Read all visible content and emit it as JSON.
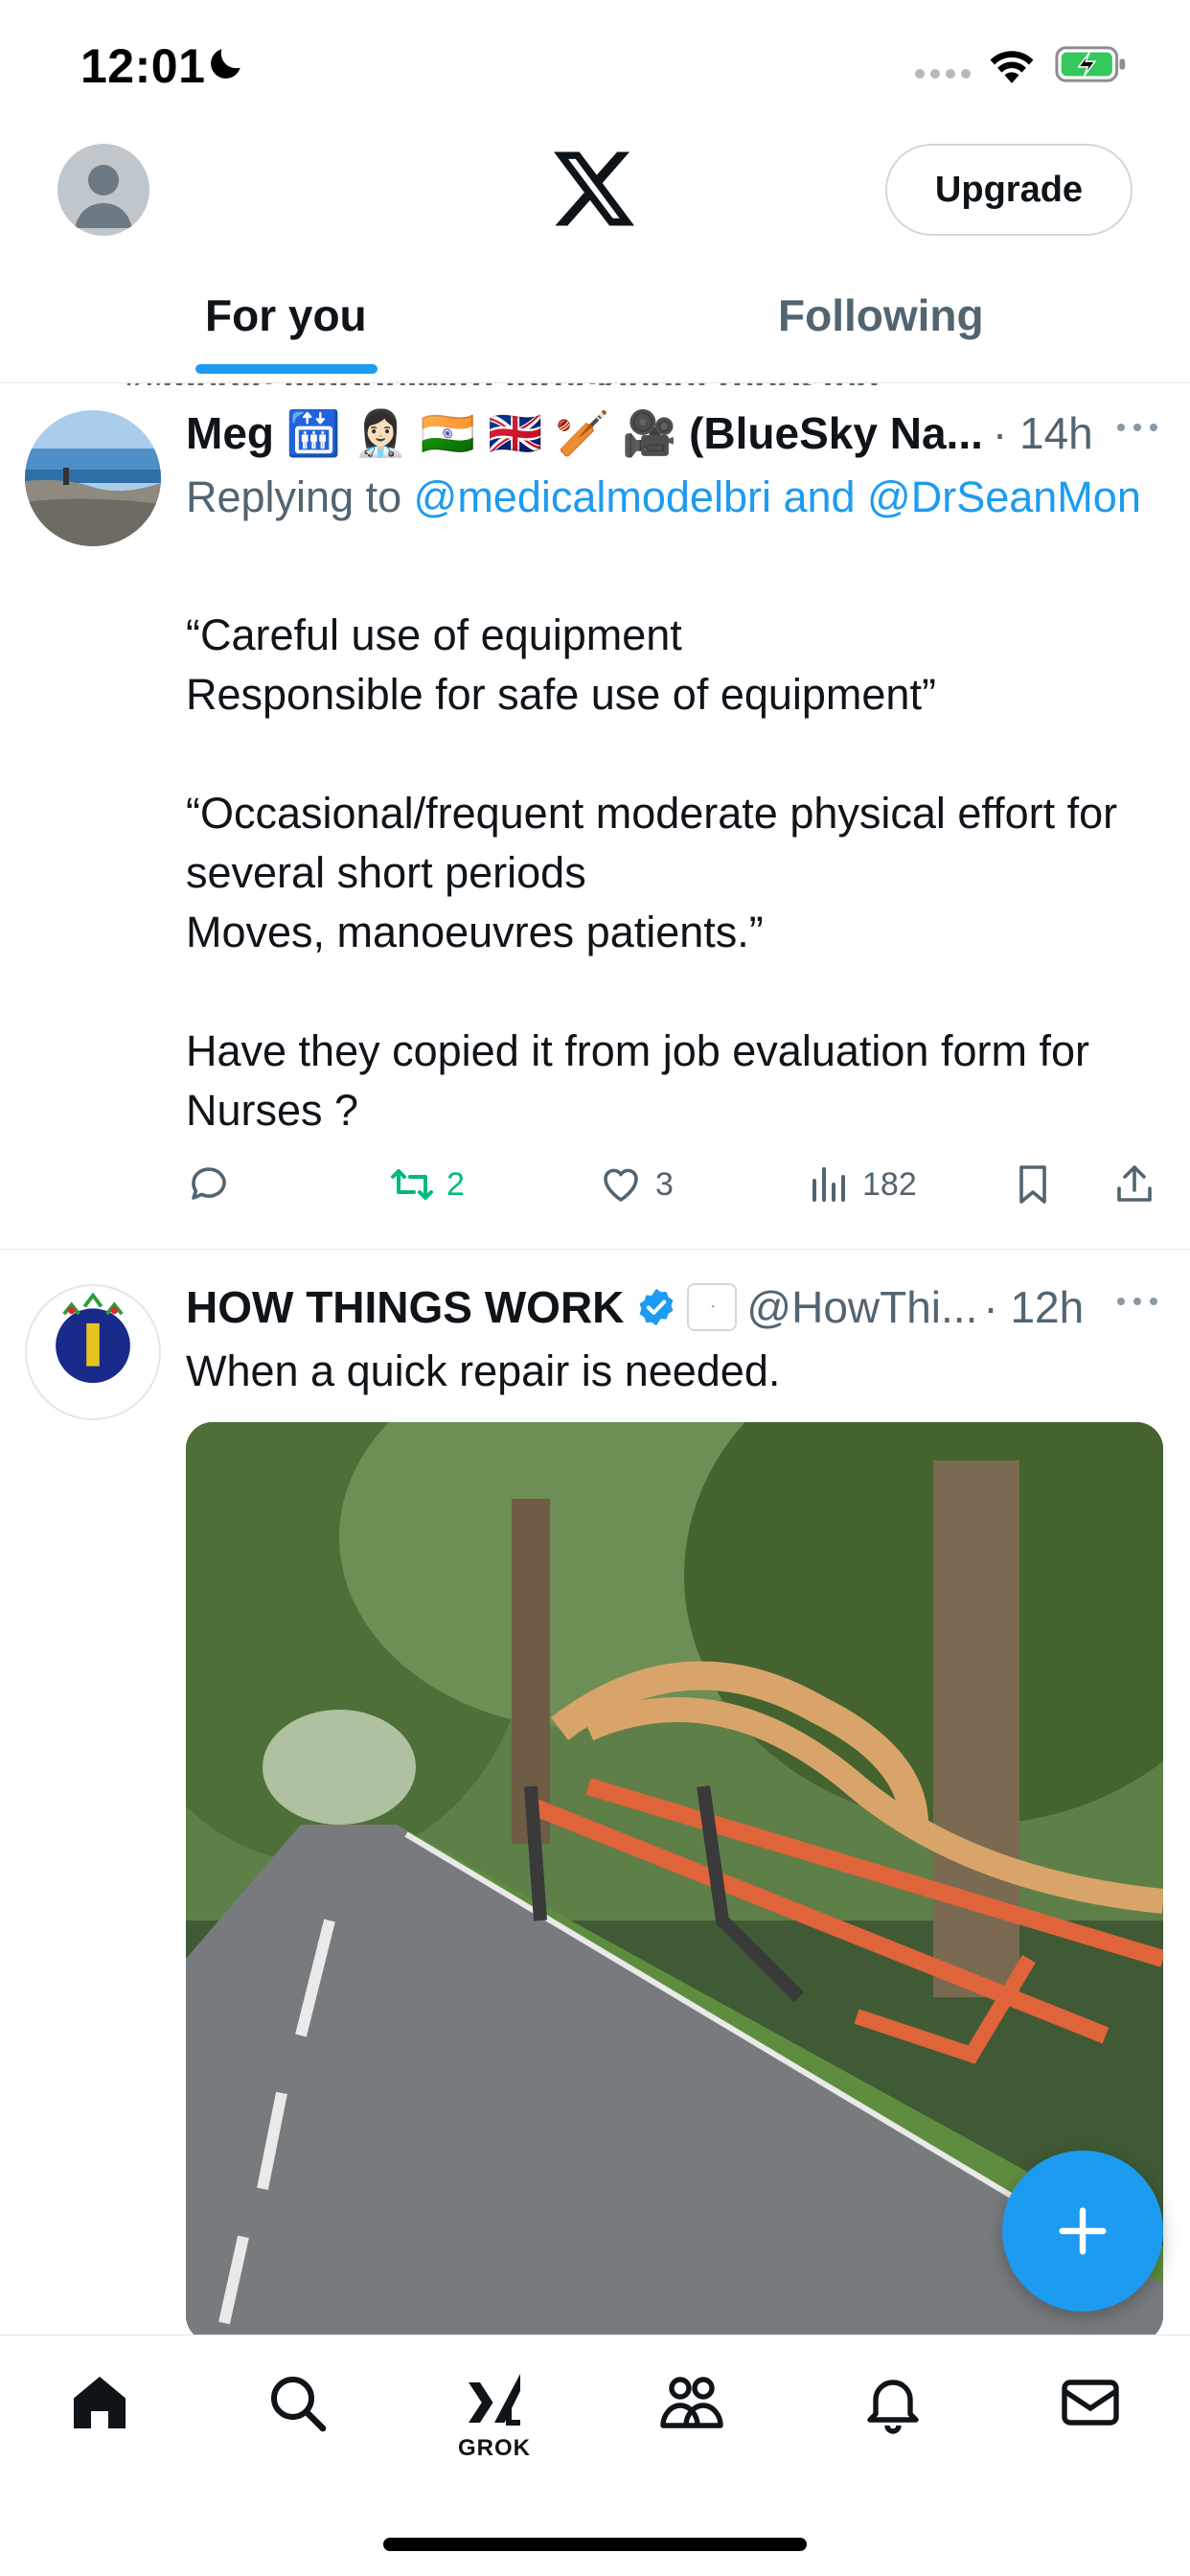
{
  "status_bar": {
    "time": "12:01",
    "icons": [
      "moon-icon",
      "cellular-signal-icon",
      "wifi-icon",
      "battery-charging-icon"
    ]
  },
  "header": {
    "logo": "x-logo",
    "upgrade_label": "Upgrade",
    "tabs": [
      {
        "label": "For you",
        "active": true
      },
      {
        "label": "Following",
        "active": false
      }
    ]
  },
  "feed": {
    "repost_banner": "@medicalmodelwithabrecklebul reposted",
    "tweets": [
      {
        "author": "Meg 🛗 👩🏻‍⚕️ 🇮🇳 🇬🇧 🏏 🎥 (BlueSky Na...",
        "meta": "· 14h",
        "replying_prefix": "Replying to ",
        "replying_mentions": "@medicalmodelbri and @DrSeanMon",
        "text": "“Careful use of equipment\nResponsible for safe use of equipment”\n\n“Occasional/frequent moderate physical effort for several short periods\nMoves, manoeuvres patients.”\n\nHave they copied it from job evaluation form for Nurses ?",
        "actions": {
          "reply": "",
          "retweets": "2",
          "likes": "3",
          "views": "182"
        }
      },
      {
        "author": "HOW THINGS WORK",
        "verified": true,
        "handle": "@HowThi...",
        "meta": "· 12h",
        "text": "When a quick repair is needed."
      }
    ]
  },
  "fab_label": "+",
  "bottom_nav": {
    "items": [
      "home-icon",
      "search-icon",
      "grok-icon",
      "communities-icon",
      "notifications-icon",
      "messages-icon"
    ],
    "grok_label": "GROK"
  },
  "colors": {
    "accent": "#1d9bf0",
    "retweet_green": "#00ba7c",
    "secondary_text": "#536471"
  }
}
